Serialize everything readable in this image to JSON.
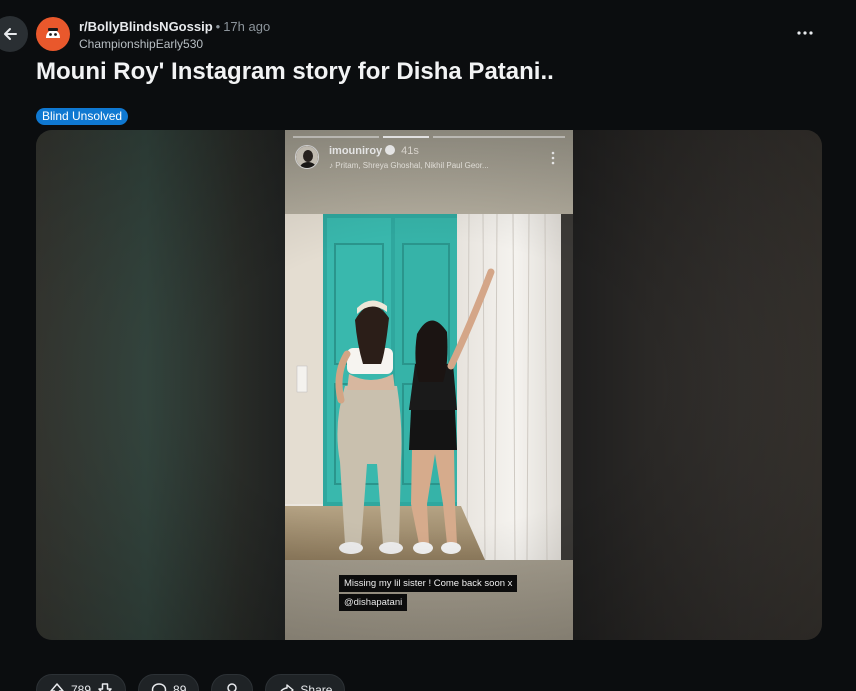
{
  "post": {
    "subreddit": "r/BollyBlindsNGossip",
    "separator": "•",
    "time_ago": "17h ago",
    "author": "ChampionshipEarly530",
    "title": "Mouni Roy' Instagram story for Disha Patani..",
    "flair": "Blind Unsolved"
  },
  "story": {
    "username": "imouniroy",
    "age": "41s",
    "music": "Pritam, Shreya Ghoshal, Nikhil Paul Geor...",
    "caption_line1": "Missing my lil sister ! Come back soon x",
    "caption_line2": "@dishapatani"
  },
  "actions": {
    "upvotes": "789",
    "comments": "89",
    "share": "Share"
  },
  "colors": {
    "background": "#0b0d0f",
    "flair": "#0f78d1",
    "subreddit_icon": "#e9582c",
    "door": "#39b8ad"
  },
  "icons": [
    "back-arrow-icon",
    "subreddit-icon",
    "more-options-icon",
    "upvote-icon",
    "downvote-icon",
    "comment-icon",
    "award-icon",
    "share-icon",
    "verified-icon",
    "music-icon"
  ]
}
